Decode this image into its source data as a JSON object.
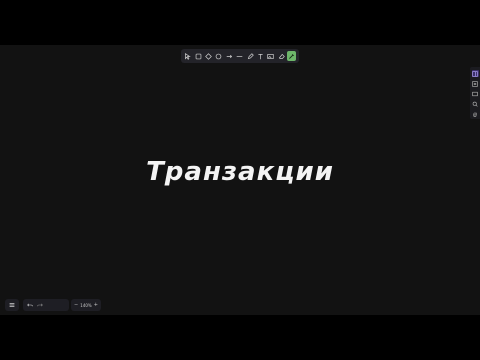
{
  "canvas": {
    "text": "Транзакции"
  },
  "toolbar": {
    "tools": [
      {
        "name": "select-tool",
        "icon": "cursor-icon"
      },
      {
        "name": "rectangle-tool",
        "icon": "square-icon"
      },
      {
        "name": "diamond-tool",
        "icon": "diamond-icon"
      },
      {
        "name": "ellipse-tool",
        "icon": "circle-icon"
      },
      {
        "name": "arrow-tool",
        "icon": "arrow-icon"
      },
      {
        "name": "line-tool",
        "icon": "line-icon"
      },
      {
        "name": "draw-tool",
        "icon": "pencil-icon"
      },
      {
        "name": "text-tool",
        "icon": "text-icon"
      },
      {
        "name": "image-tool",
        "icon": "image-icon"
      },
      {
        "name": "eraser-tool",
        "icon": "eraser-icon"
      },
      {
        "name": "laser-tool",
        "icon": "laser-icon",
        "active": true
      }
    ],
    "active_color": "#6db56a"
  },
  "side_panel": {
    "items": [
      "sidebar-toggle-icon",
      "library-icon",
      "frame-icon",
      "search-icon",
      "hand-icon"
    ]
  },
  "bottom": {
    "zoom_level": "140%",
    "zoom_out": "−",
    "zoom_in": "+"
  },
  "colors": {
    "background": "#121212",
    "toolbar": "#232329",
    "text": "#f4f4f4"
  }
}
